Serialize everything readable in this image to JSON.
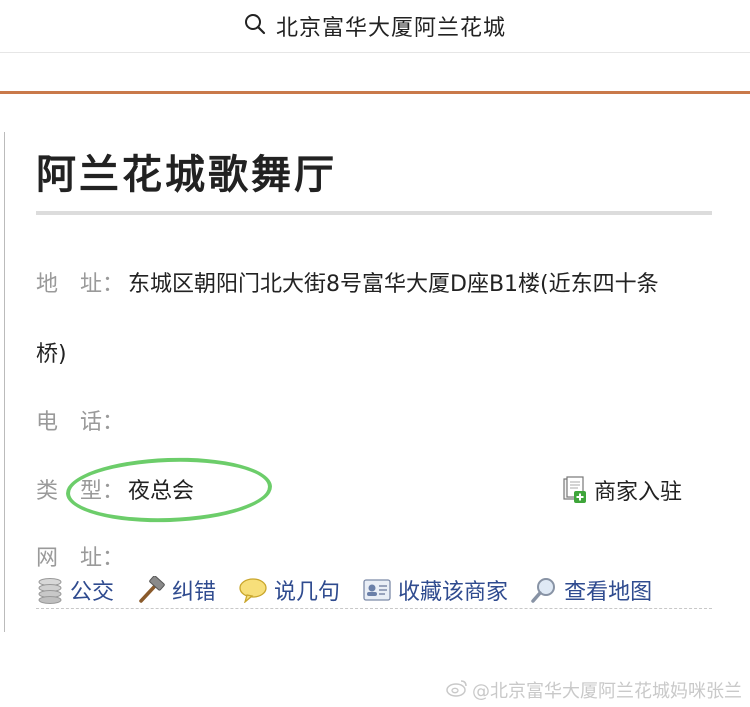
{
  "search": {
    "query": "北京富华大厦阿兰花城"
  },
  "business": {
    "name": "阿兰花城歌舞厅",
    "address_label": "地　址：",
    "address_line1": "东城区朝阳门北大街8号富华大厦D座B1楼(近东四十条",
    "address_line2": "桥)",
    "phone_label": "电　话：",
    "phone": "",
    "type_label": "类　型：",
    "type": "夜总会",
    "website_label": "网　址：",
    "website": ""
  },
  "merchant_join": {
    "label": "商家入驻"
  },
  "actions": {
    "bus": "公交",
    "correct": "纠错",
    "comment": "说几句",
    "favorite": "收藏该商家",
    "map": "查看地图"
  },
  "watermark": {
    "text": "@北京富华大厦阿兰花城妈咪张兰"
  },
  "colors": {
    "accent_rule": "#c9794a",
    "link": "#2f4b8f",
    "highlight_circle": "#5cc85a"
  }
}
